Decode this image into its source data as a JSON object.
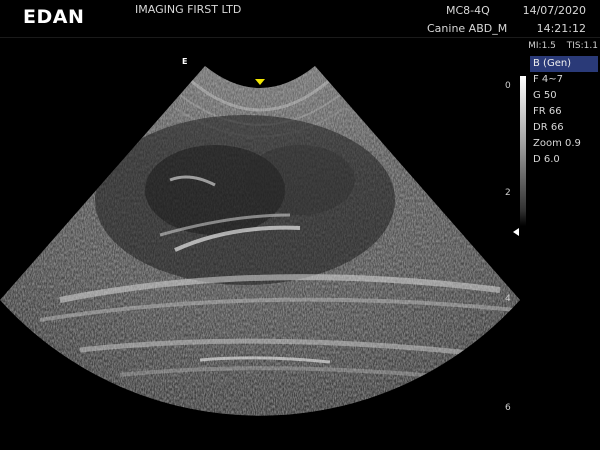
{
  "header": {
    "brand": "EDAN",
    "institution": "IMAGING FIRST LTD",
    "probe": "MC8-4Q",
    "exam_preset": "Canine ABD_M",
    "date": "14/07/2020",
    "time": "14:21:12"
  },
  "indices": {
    "mi": "MI:1.5",
    "tis": "TIS:1.1"
  },
  "parameters": {
    "mode": "B (Gen)",
    "items": [
      {
        "label": "F 4~7"
      },
      {
        "label": "G 50"
      },
      {
        "label": "FR 66"
      },
      {
        "label": "DR 66"
      },
      {
        "label": "Zoom 0.9"
      },
      {
        "label": "D 6.0"
      }
    ]
  },
  "depth_scale": {
    "unit_labels": [
      "0",
      "2",
      "4",
      "6"
    ]
  },
  "image": {
    "orientation_marker": "E",
    "focus_marker_color": "#f2e600",
    "mode_highlight_color": "#2a3a78"
  }
}
